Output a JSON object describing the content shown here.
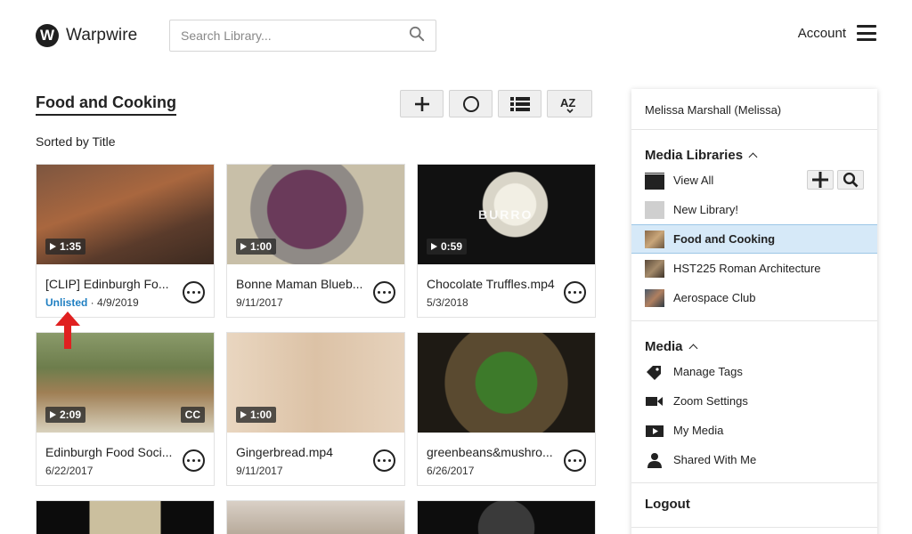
{
  "header": {
    "logo_text": "Warpwire",
    "logo_letter": "W",
    "search_placeholder": "Search Library...",
    "account_label": "Account"
  },
  "main": {
    "title": "Food and Cooking",
    "sorted_label": "Sorted by Title",
    "toolbar": {
      "sort_label": "AZ"
    },
    "cards": [
      {
        "title": "[CLIP] Edinburgh Fo...",
        "duration": "1:35",
        "status": "Unlisted",
        "date": "4/9/2019",
        "cc": ""
      },
      {
        "title": "Bonne Maman Blueb...",
        "duration": "1:00",
        "status": "",
        "date": "9/11/2017",
        "cc": ""
      },
      {
        "title": "Chocolate Truffles.mp4",
        "duration": "0:59",
        "status": "",
        "date": "5/3/2018",
        "cc": "",
        "overlay": "BURRO"
      },
      {
        "title": "Edinburgh Food Soci...",
        "duration": "2:09",
        "status": "",
        "date": "6/22/2017",
        "cc": "CC"
      },
      {
        "title": "Gingerbread.mp4",
        "duration": "1:00",
        "status": "",
        "date": "9/11/2017",
        "cc": ""
      },
      {
        "title": "greenbeans&mushro...",
        "duration": "",
        "status": "",
        "date": "6/26/2017",
        "cc": ""
      }
    ],
    "separator": " · "
  },
  "panel": {
    "user": "Melissa Marshall (Melissa)",
    "libraries_heading": "Media Libraries",
    "libraries": [
      {
        "label": "View All"
      },
      {
        "label": "New Library!"
      },
      {
        "label": "Food and Cooking"
      },
      {
        "label": "HST225 Roman Architecture"
      },
      {
        "label": "Aerospace Club"
      }
    ],
    "media_heading": "Media",
    "media_items": [
      {
        "label": "Manage Tags"
      },
      {
        "label": "Zoom Settings"
      },
      {
        "label": "My Media"
      },
      {
        "label": "Shared With Me"
      }
    ],
    "logout": "Logout"
  },
  "colors": {
    "accent": "#1f7fc2",
    "active_bg": "#d6e9f8",
    "arrow": "#e02020"
  }
}
